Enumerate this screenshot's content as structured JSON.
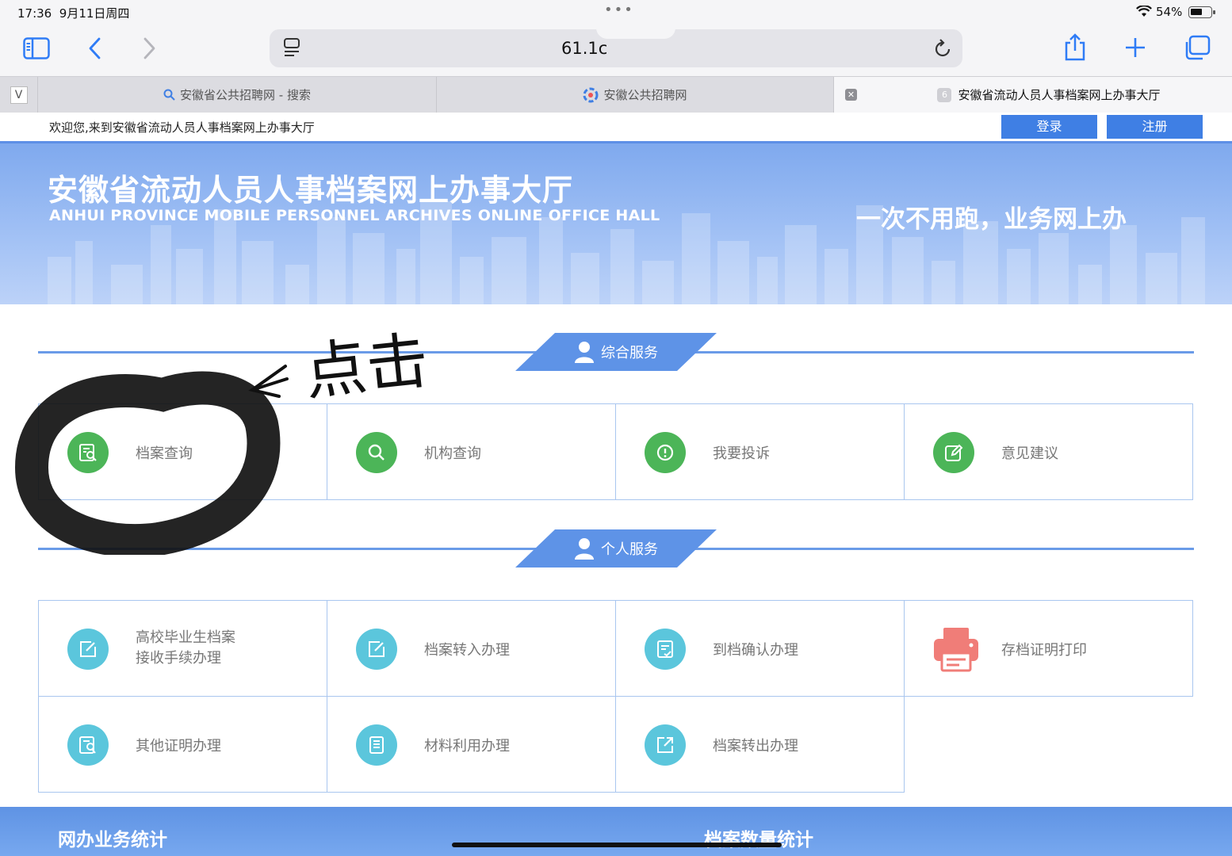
{
  "status_bar": {
    "time": "17:36",
    "date": "9月11日周四",
    "battery": "54%"
  },
  "browser": {
    "url": "61.1с",
    "tabs": [
      {
        "label": "安徽省公共招聘网 - 搜索",
        "icon": "search-icon"
      },
      {
        "label": "安徽公共招聘网",
        "icon": "site-logo-icon"
      },
      {
        "label": "安徽省流动人员人事档案网上办事大厅",
        "badge": "6",
        "active": true
      }
    ],
    "first_tab_icon_text": "V"
  },
  "welcome": {
    "message": "欢迎您,来到安徽省流动人员人事档案网上办事大厅",
    "login": "登录",
    "register": "注册"
  },
  "banner": {
    "title": "安徽省流动人员人事档案网上办事大厅",
    "subtitle": "ANHUI PROVINCE MOBILE PERSONNEL ARCHIVES ONLINE OFFICE HALL",
    "slogan": "一次不用跑，业务网上办"
  },
  "annotation": {
    "text": "点击",
    "arrow": "arrow-left"
  },
  "general_services": {
    "title": "综合服务",
    "items": [
      {
        "label": "档案查询",
        "icon": "archive-search-icon",
        "color": "#4cb558"
      },
      {
        "label": "机构查询",
        "icon": "search-icon",
        "color": "#4cb558"
      },
      {
        "label": "我要投诉",
        "icon": "alert-icon",
        "color": "#4cb558"
      },
      {
        "label": "意见建议",
        "icon": "edit-icon",
        "color": "#4cb558"
      }
    ]
  },
  "personal_services": {
    "title": "个人服务",
    "items": [
      {
        "label1": "高校毕业生档案",
        "label2": "接收手续办理",
        "icon": "edit-box-icon"
      },
      {
        "label": "档案转入办理",
        "icon": "edit-box-icon"
      },
      {
        "label": "到档确认办理",
        "icon": "checklist-icon"
      },
      {
        "label": "存档证明打印",
        "icon": "printer-icon"
      },
      {
        "label": "其他证明办理",
        "icon": "certificate-icon"
      },
      {
        "label": "材料利用办理",
        "icon": "document-icon"
      },
      {
        "label": "档案转出办理",
        "icon": "export-icon"
      }
    ]
  },
  "footer": {
    "left_title": "网办业务统计",
    "right_title": "档案数量统计"
  },
  "colors": {
    "primary": "#3f7fe4",
    "green": "#4cb558",
    "teal": "#5bc6dc",
    "printer": "#f07d78"
  }
}
